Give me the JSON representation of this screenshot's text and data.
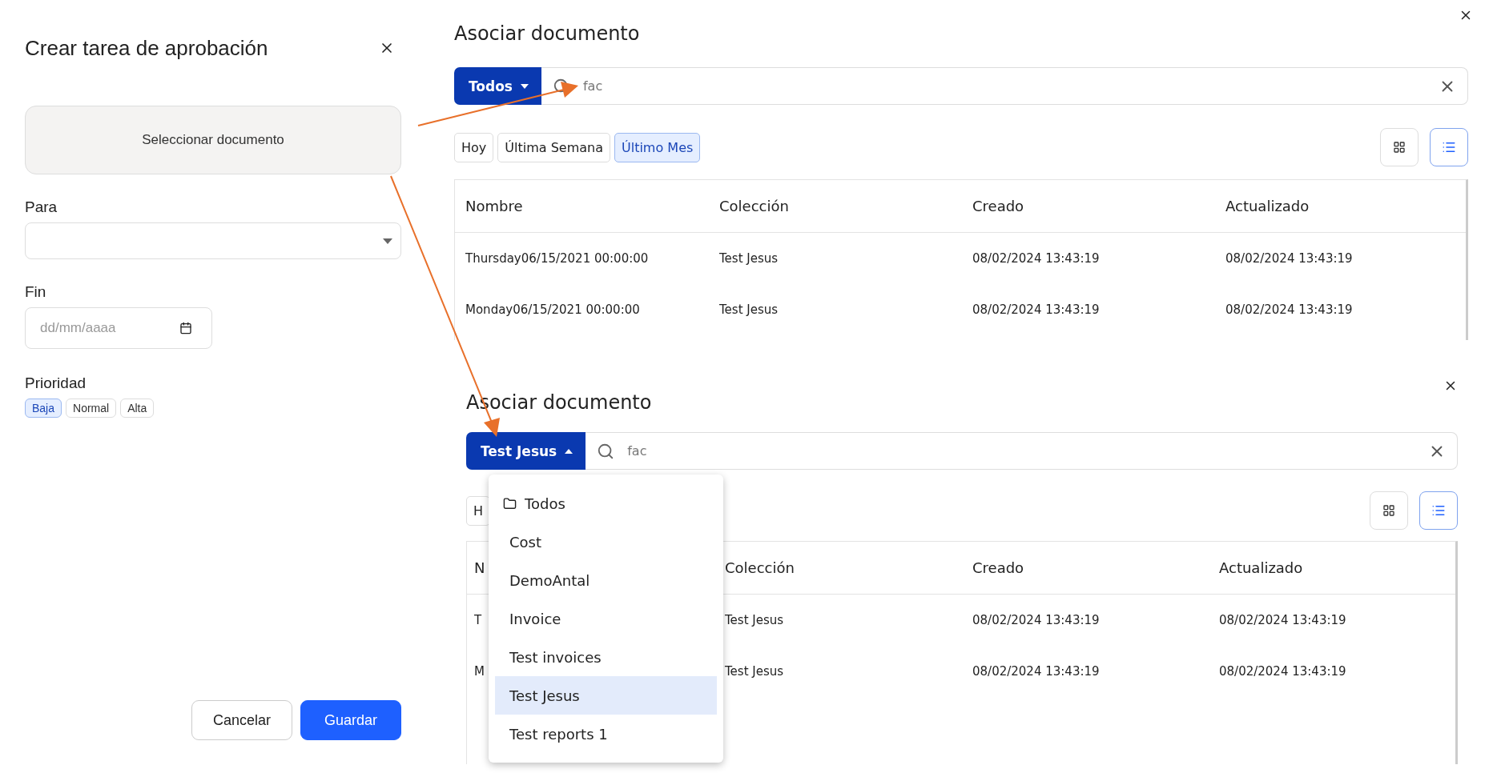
{
  "approval_panel": {
    "title": "Crear tarea de aprobación",
    "select_document": "Seleccionar documento",
    "fields": [
      {
        "label": "Para",
        "kind": "select"
      },
      {
        "label": "Fin",
        "kind": "date",
        "placeholder": "dd/mm/aaaa"
      }
    ],
    "priority": {
      "label": "Prioridad",
      "options": [
        {
          "label": "Baja",
          "selected": true
        },
        {
          "label": "Normal",
          "selected": false
        },
        {
          "label": "Alta",
          "selected": false
        }
      ]
    },
    "buttons": [
      {
        "label": "Cancelar",
        "kind": "secondary"
      },
      {
        "label": "Guardar",
        "kind": "primary"
      }
    ]
  },
  "dialogs": [
    {
      "title": "Asociar documento",
      "collection_button": {
        "label": "Todos",
        "expanded": false
      },
      "search": {
        "value": "fac"
      },
      "date_filters": [
        {
          "label": "Hoy",
          "selected": false
        },
        {
          "label": "Última Semana",
          "selected": false
        },
        {
          "label": "Último Mes",
          "selected": true
        }
      ],
      "views": [
        {
          "kind": "grid",
          "selected": false
        },
        {
          "kind": "list",
          "selected": true
        }
      ],
      "table": {
        "columns": [
          "Nombre",
          "Colección",
          "Creado",
          "Actualizado"
        ],
        "rows": [
          [
            "Thursday06/15/2021 00:00:00",
            "Test Jesus",
            "08/02/2024 13:43:19",
            "08/02/2024 13:43:19"
          ],
          [
            "Monday06/15/2021 00:00:00",
            "Test Jesus",
            "08/02/2024 13:43:19",
            "08/02/2024 13:43:19"
          ]
        ]
      }
    },
    {
      "title": "Asociar documento",
      "collection_button": {
        "label": "Test Jesus",
        "expanded": true
      },
      "search": {
        "value": "fac"
      },
      "date_filters": [
        {
          "label": "H",
          "selected": false
        }
      ],
      "views": [
        {
          "kind": "grid",
          "selected": false
        },
        {
          "kind": "list",
          "selected": true
        }
      ],
      "table": {
        "columns": [
          "N",
          "Colección",
          "Creado",
          "Actualizado"
        ],
        "rows": [
          [
            "T",
            "Test Jesus",
            "08/02/2024 13:43:19",
            "08/02/2024 13:43:19"
          ],
          [
            "M",
            "Test Jesus",
            "08/02/2024 13:43:19",
            "08/02/2024 13:43:19"
          ]
        ]
      },
      "dropdown": {
        "items": [
          {
            "label": "Todos",
            "kind": "folder",
            "selected": false
          },
          {
            "label": "Cost",
            "kind": "collection",
            "selected": false
          },
          {
            "label": "DemoAntal",
            "kind": "collection",
            "selected": false
          },
          {
            "label": "Invoice",
            "kind": "collection",
            "selected": false
          },
          {
            "label": "Test invoices",
            "kind": "collection",
            "selected": false
          },
          {
            "label": "Test Jesus",
            "kind": "collection",
            "selected": true
          },
          {
            "label": "Test reports 1",
            "kind": "collection",
            "selected": false
          }
        ]
      }
    }
  ]
}
